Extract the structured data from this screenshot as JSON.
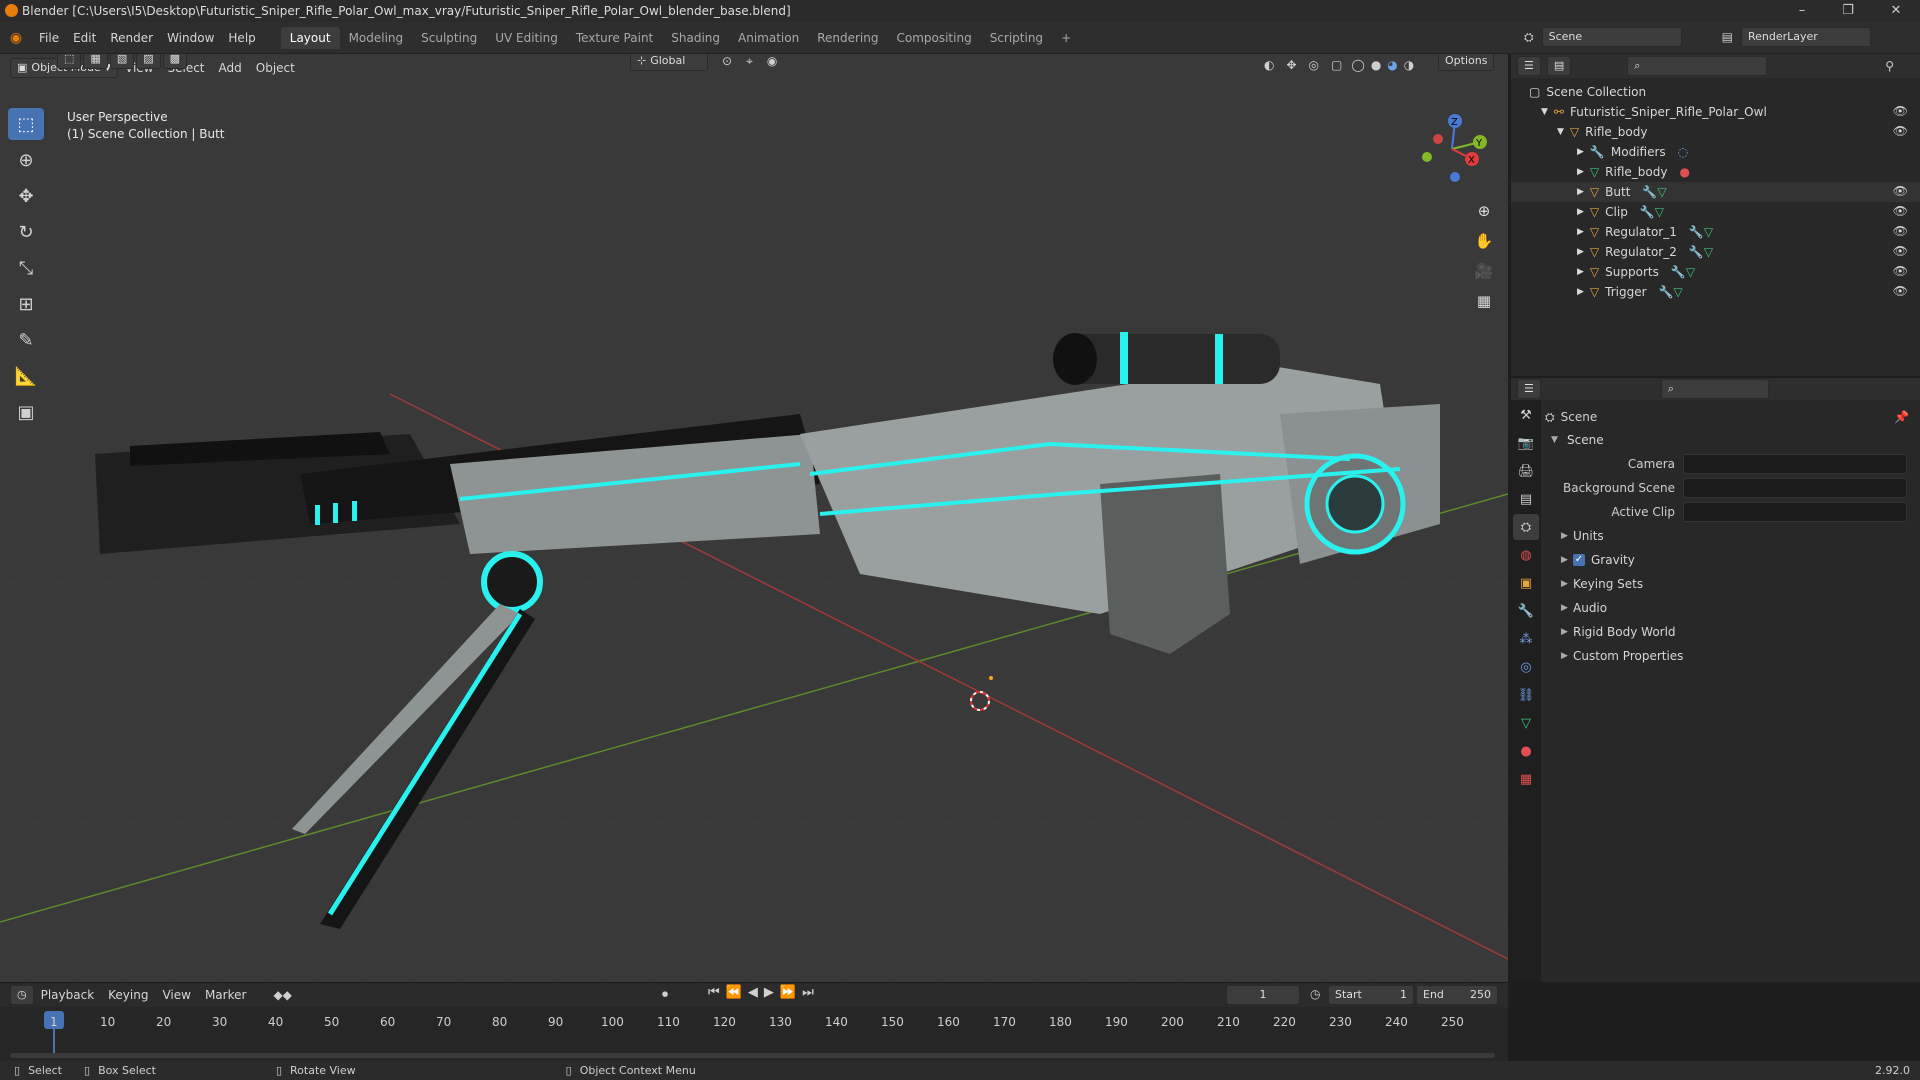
{
  "window": {
    "title": "Blender [C:\\Users\\I5\\Desktop\\Futuristic_Sniper_Rifle_Polar_Owl_max_vray/Futuristic_Sniper_Rifle_Polar_Owl_blender_base.blend]",
    "minimize": "–",
    "maximize": "❐",
    "close": "✕"
  },
  "menu": {
    "items": [
      "File",
      "Edit",
      "Render",
      "Window",
      "Help"
    ]
  },
  "workspaces": {
    "tabs": [
      "Layout",
      "Modeling",
      "Sculpting",
      "UV Editing",
      "Texture Paint",
      "Shading",
      "Animation",
      "Rendering",
      "Compositing",
      "Scripting"
    ],
    "active": "Layout",
    "add": "+"
  },
  "top_right": {
    "scene": "Scene",
    "render_layer": "RenderLayer"
  },
  "viewport": {
    "mode": "Object Mode",
    "menus": [
      "View",
      "Select",
      "Add",
      "Object"
    ],
    "orientation": "Global",
    "options": "Options",
    "info_line1": "User Perspective",
    "info_line2": "(1) Scene Collection | Butt",
    "gizmo": {
      "x": "X",
      "y": "Y",
      "z": "Z"
    }
  },
  "outliner": {
    "root": "Scene Collection",
    "collection": "Futuristic_Sniper_Rifle_Polar_Owl",
    "parent": "Rifle_body",
    "children": [
      "Modifiers",
      "Rifle_body",
      "Butt",
      "Clip",
      "Regulator_1",
      "Regulator_2",
      "Supports",
      "Trigger"
    ]
  },
  "properties": {
    "context": "Scene",
    "panel": "Scene",
    "fields": [
      {
        "label": "Camera",
        "value": ""
      },
      {
        "label": "Background Scene",
        "value": ""
      },
      {
        "label": "Active Clip",
        "value": ""
      }
    ],
    "subpanels": [
      "Units",
      "Gravity",
      "Keying Sets",
      "Audio",
      "Rigid Body World",
      "Custom Properties"
    ],
    "gravity_checked": true
  },
  "timeline": {
    "menus": [
      "Playback",
      "Keying",
      "View",
      "Marker"
    ],
    "current_frame": "1",
    "start_label": "Start",
    "start": "1",
    "end_label": "End",
    "end": "250",
    "ticks": [
      "1",
      "10",
      "20",
      "30",
      "40",
      "50",
      "60",
      "70",
      "80",
      "90",
      "100",
      "110",
      "120",
      "130",
      "140",
      "150",
      "160",
      "170",
      "180",
      "190",
      "200",
      "210",
      "220",
      "230",
      "240",
      "250"
    ]
  },
  "status": {
    "select": "Select",
    "box_select": "Box Select",
    "rotate": "Rotate View",
    "context_menu": "Object Context Menu",
    "version": "2.92.0"
  },
  "colors": {
    "accent": "#4772b3",
    "cyan": "#29f2ee",
    "orange": "#e87d0d"
  }
}
